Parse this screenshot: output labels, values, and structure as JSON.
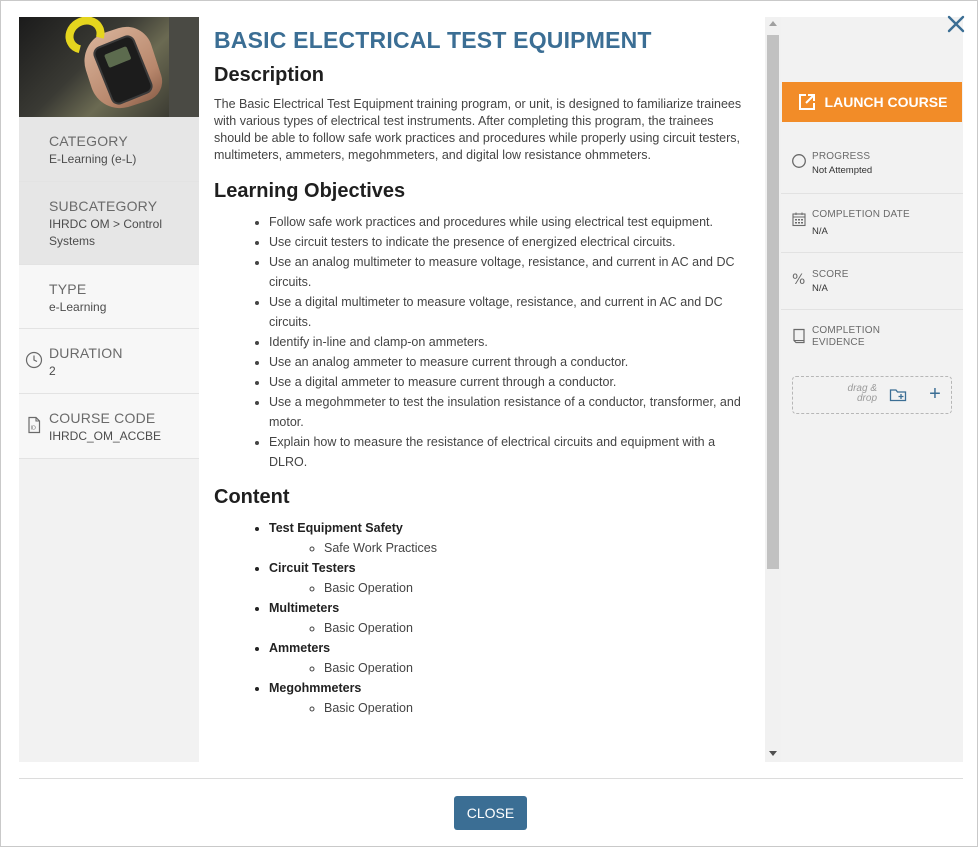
{
  "colors": {
    "accent": "#3b6e94",
    "launch": "#f28c28"
  },
  "course": {
    "title": "BASIC ELECTRICAL TEST EQUIPMENT",
    "image_icon": "multimeter-photo"
  },
  "meta": {
    "category": {
      "label": "CATEGORY",
      "value": "E-Learning (e-L)"
    },
    "subcategory": {
      "label": "SUBCATEGORY",
      "value": "IHRDC OM > Control Systems"
    },
    "type": {
      "label": "TYPE",
      "value": "e-Learning"
    },
    "duration": {
      "label": "DURATION",
      "value": "2",
      "icon": "clock-icon"
    },
    "course_code": {
      "label": "COURSE CODE",
      "value": "IHRDC_OM_ACCBE",
      "icon": "id-card-icon"
    }
  },
  "description": {
    "heading": "Description",
    "text": "The Basic Electrical Test Equipment training program, or unit, is designed to familiarize trainees with various types of electrical test instruments. After completing this program, the trainees should be able to follow safe work practices and procedures while properly using circuit testers, multimeters, ammeters, megohmmeters, and digital low resistance ohmmeters."
  },
  "objectives": {
    "heading": "Learning Objectives",
    "items": [
      "Follow safe work practices and procedures while using electrical test equipment.",
      "Use circuit testers to indicate the presence of energized electrical circuits.",
      "Use an analog multimeter to measure voltage, resistance, and current in AC and DC circuits.",
      "Use a digital multimeter to measure voltage, resistance, and current in AC and DC circuits.",
      "Identify in-line and clamp-on ammeters.",
      "Use an analog ammeter to measure current through a conductor.",
      "Use a digital ammeter to measure current through a conductor.",
      "Use a megohmmeter to test the insulation resistance of a conductor, transformer, and motor.",
      "Explain how to measure the resistance of electrical circuits and equipment with a DLRO."
    ]
  },
  "content": {
    "heading": "Content",
    "topics": [
      {
        "name": "Test Equipment Safety",
        "sub": "Safe Work Practices"
      },
      {
        "name": "Circuit Testers",
        "sub": "Basic Operation"
      },
      {
        "name": "Multimeters",
        "sub": "Basic Operation"
      },
      {
        "name": "Ammeters",
        "sub": "Basic Operation"
      },
      {
        "name": "Megohmmeters",
        "sub": "Basic Operation"
      }
    ]
  },
  "actions": {
    "launch_label": "LAUNCH COURSE",
    "close_label": "CLOSE"
  },
  "status": {
    "progress": {
      "label": "PROGRESS",
      "value": "Not Attempted"
    },
    "completion_date": {
      "label": "COMPLETION DATE",
      "value": "N/A"
    },
    "score": {
      "label": "SCORE",
      "value": "N/A"
    },
    "evidence": {
      "label": "COMPLETION EVIDENCE"
    },
    "dropzone_text": "drag & drop"
  }
}
